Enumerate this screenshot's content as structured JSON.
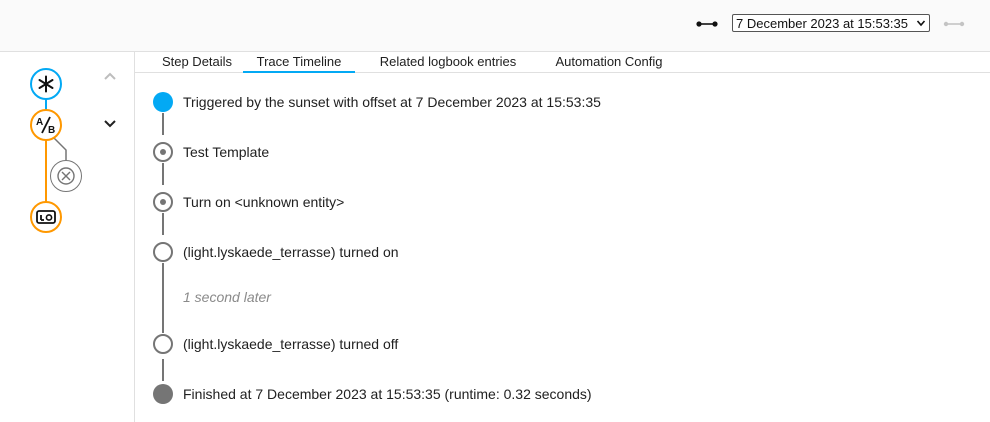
{
  "header": {
    "range_icon": "range-arrows-icon",
    "trace_select_value": "7 December 2023 at 15:53:35",
    "next_icon": "range-arrows-disabled-icon"
  },
  "graph": {
    "nodes": [
      {
        "type": "trigger",
        "icon": "asterisk-icon",
        "color": "#03a9f4"
      },
      {
        "type": "choose",
        "icon": "a-b-icon",
        "color": "#ff9800"
      },
      {
        "type": "skipped",
        "icon": "close-icon",
        "color": "#757575"
      },
      {
        "type": "action",
        "icon": "lightbulb-device-icon",
        "color": "#ff9800"
      }
    ],
    "up_icon": "chevron-up-icon",
    "down_icon": "chevron-down-icon"
  },
  "tabs": [
    {
      "label": "Step Details",
      "active": false
    },
    {
      "label": "Trace Timeline",
      "active": true
    },
    {
      "label": "Related logbook entries",
      "active": false
    },
    {
      "label": "Automation Config",
      "active": false
    }
  ],
  "timeline": {
    "entries": [
      {
        "text": "Triggered by the sunset with offset at 7 December 2023 at 15:53:35",
        "kind": "trigger",
        "color": "#03a9f4"
      },
      {
        "text": "Test Template",
        "kind": "step"
      },
      {
        "text": "Turn on <unknown entity>",
        "kind": "step"
      },
      {
        "text": "(light.lyskaede_terrasse) turned on",
        "kind": "event"
      },
      {
        "text": "(light.lyskaede_terrasse) turned off",
        "kind": "event"
      },
      {
        "text": "Finished at 7 December 2023 at 15:53:35 (runtime: 0.32 seconds)",
        "kind": "finish",
        "color": "#757575"
      }
    ],
    "delay_note": "1 second later"
  }
}
